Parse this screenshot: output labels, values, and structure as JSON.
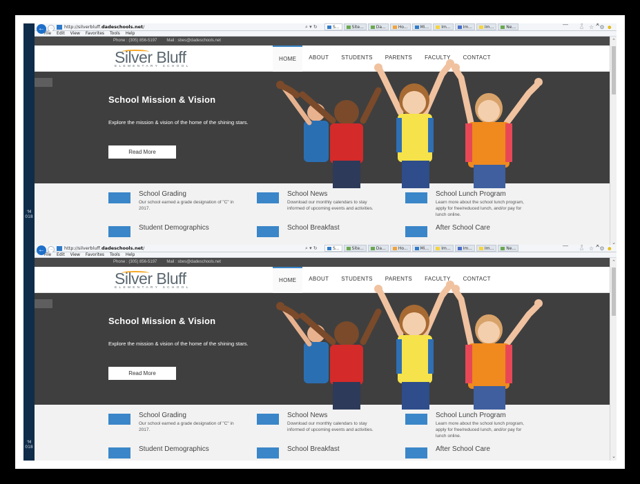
{
  "browser": {
    "url_prefix": "http://silverbluff.",
    "url_domain": "dadeschools.net",
    "url_suffix": "/",
    "search_controls": "⌕ ▾ ↻",
    "tabs": [
      {
        "label": "S...",
        "active": true,
        "color": "#2f7ac8"
      },
      {
        "label": "Site...",
        "active": false,
        "color": "#6aa84f"
      },
      {
        "label": "Da...",
        "active": false,
        "color": "#6aa84f"
      },
      {
        "label": "Ho...",
        "active": false,
        "color": "#f1a33a"
      },
      {
        "label": "Mi...",
        "active": false,
        "color": "#2f7ac8"
      },
      {
        "label": "Im...",
        "active": false,
        "color": "#f5d442"
      },
      {
        "label": "Im...",
        "active": false,
        "color": "#4a6fc9"
      },
      {
        "label": "Im...",
        "active": false,
        "color": "#f5d442"
      },
      {
        "label": "Ne...",
        "active": false,
        "color": "#6aa84f"
      }
    ],
    "menu": [
      "File",
      "Edit",
      "View",
      "Favorites",
      "Tools",
      "Help"
    ],
    "right_icons": "⌂ ☆ ⚙",
    "smiley": "☻",
    "window_controls": "— ▫ ✕",
    "back_icon": "←",
    "forward_icon": "→",
    "scroll_up": "⌃",
    "scroll_down": "⌄"
  },
  "taskbar": {
    "time_top": "'M",
    "time_bottom": "018"
  },
  "site": {
    "phone": "Phone : (305) 856-5197",
    "mail": "Mail : sbes@dadeschools.net",
    "logo_name": "Silver Bluff",
    "logo_sub": "ELEMENTARY SCHOOL",
    "nav": [
      "HOME",
      "ABOUT",
      "STUDENTS",
      "PARENTS",
      "FACULTY",
      "CONTACT"
    ],
    "hero_title": "School Mission & Vision",
    "hero_text": "Explore the mission & vision of the home of the shining stars.",
    "hero_button": "Read More",
    "features": [
      {
        "title": "School Grading",
        "desc": "Our school earned a grade designation of \"C\" in 2017."
      },
      {
        "title": "School News",
        "desc": "Download our monthly calendars to stay informed of upcoming events and activities."
      },
      {
        "title": "School Lunch Program",
        "desc": "Learn more about the school lunch program, apply for free/reduced lunch, and/or pay for lunch online."
      },
      {
        "title": "Student Demographics",
        "desc": ""
      },
      {
        "title": "School Breakfast",
        "desc": ""
      },
      {
        "title": "After School Care",
        "desc": ""
      }
    ]
  },
  "colors": {
    "accent": "#3a86c8",
    "topbar": "#4a4a4a",
    "hero": "#3f3f3f",
    "frame": "#000000"
  }
}
